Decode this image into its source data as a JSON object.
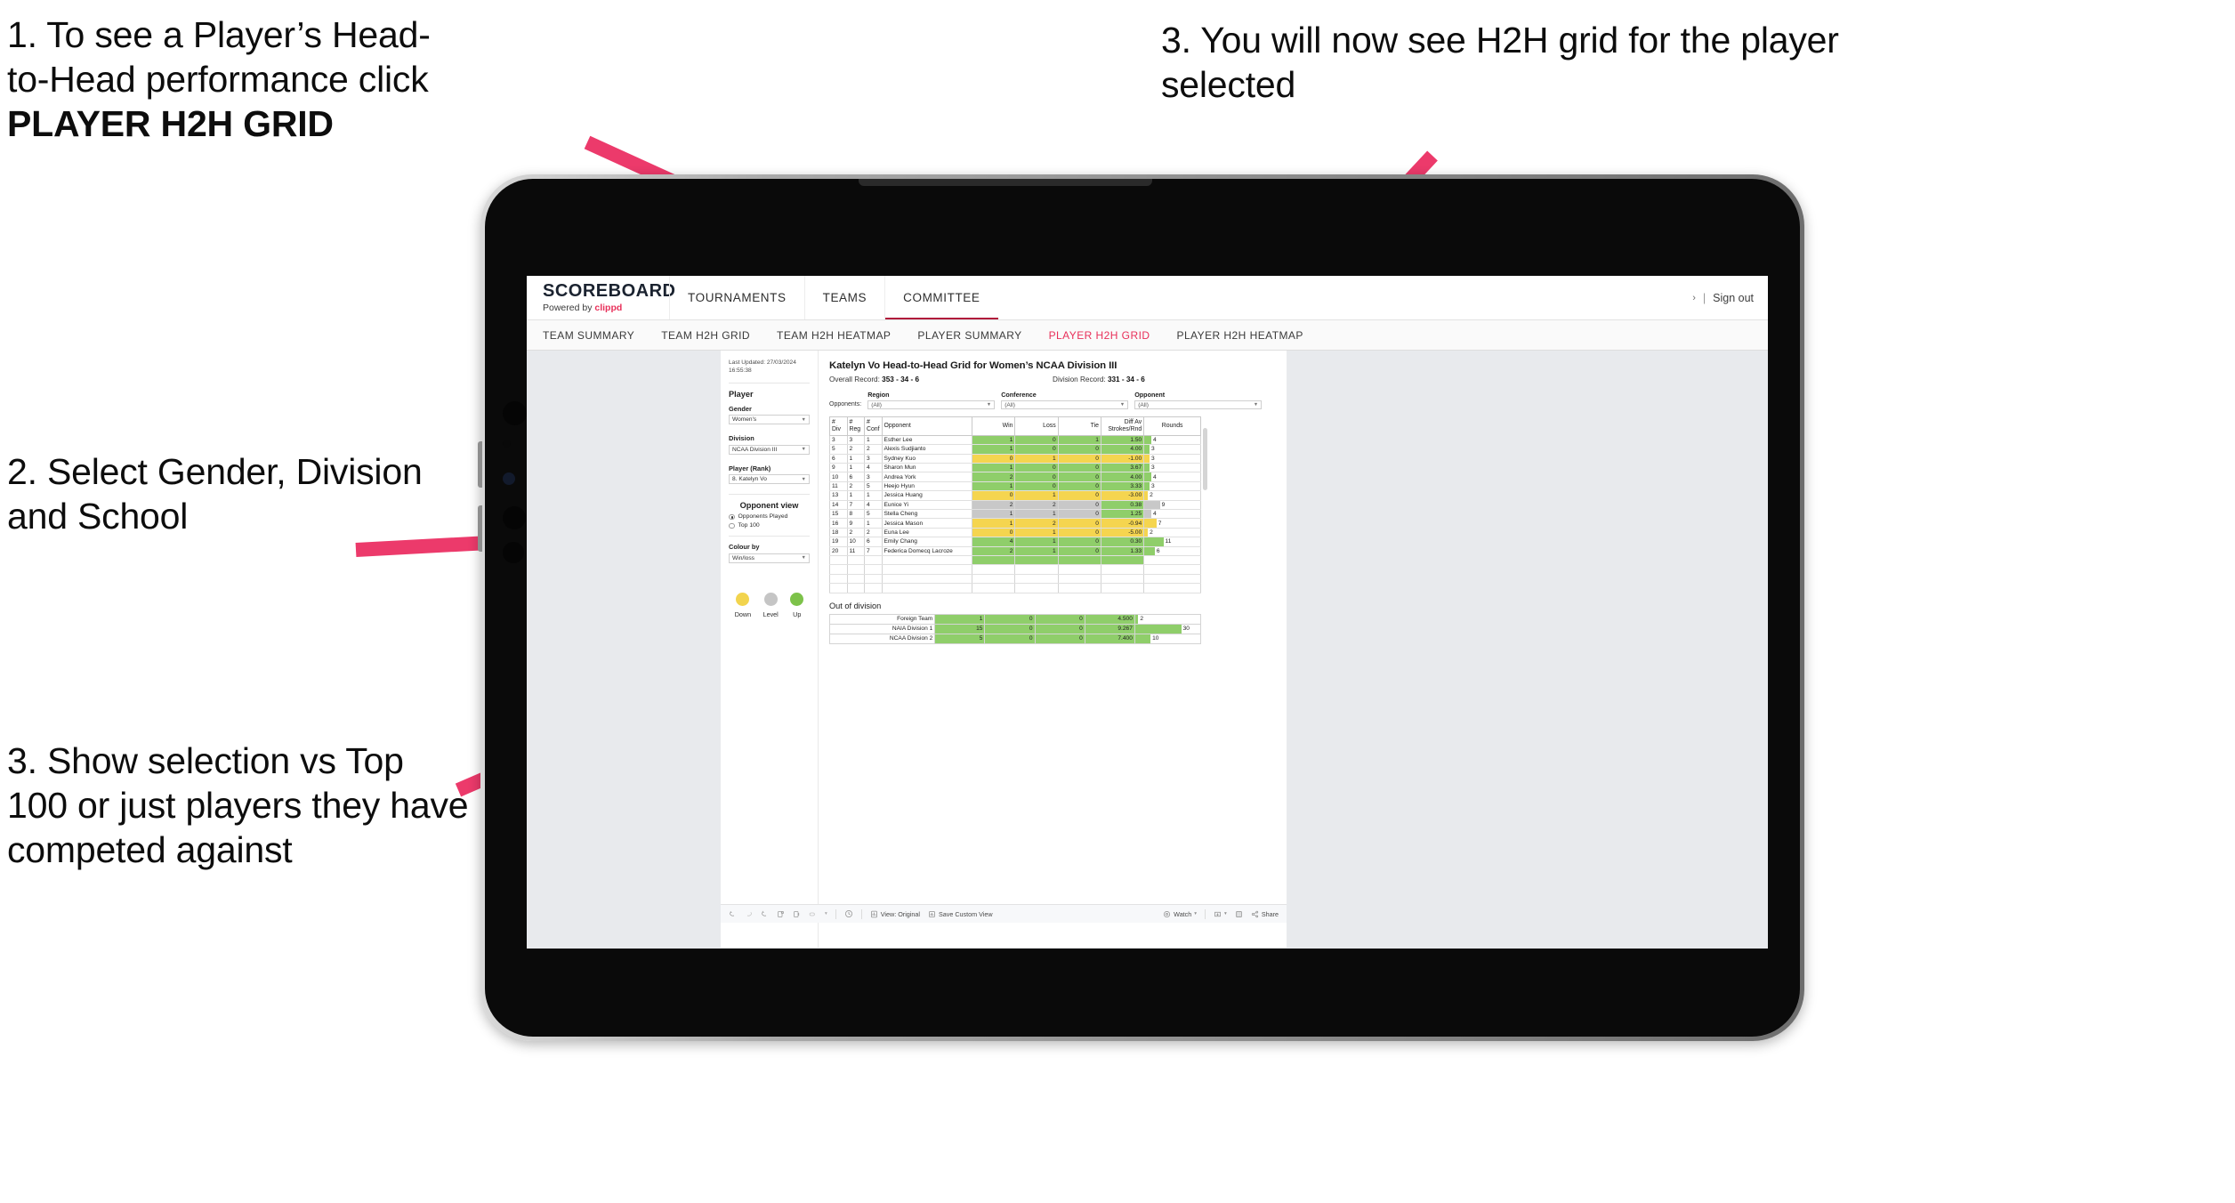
{
  "annotations": [
    {
      "id": "a1",
      "line1": "1. To see a Player’s Head-",
      "line2": "to-Head performance click",
      "line3": "PLAYER H2H GRID"
    },
    {
      "id": "a2",
      "text": "2. Select Gender, Division and School"
    },
    {
      "id": "a3",
      "text": "3. Show selection vs Top 100 or just players they have competed against"
    },
    {
      "id": "a4",
      "text": "3. You will now see H2H grid for the player selected"
    }
  ],
  "colors": {
    "accent_pink": "#e8305a",
    "arrow_pink": "#ec3a6b",
    "win_green": "#8fce6a",
    "loss_yellow": "#f5d54f",
    "level_grey": "#c8c8c8"
  },
  "app": {
    "logo": {
      "main": "SCOREBOARD",
      "powered": "Powered by",
      "brand": "clippd"
    },
    "header_nav": [
      {
        "label": "TOURNAMENTS",
        "active": false
      },
      {
        "label": "TEAMS",
        "active": false
      },
      {
        "label": "COMMITTEE",
        "active": true
      }
    ],
    "header_right": {
      "chevron": "›",
      "separator": "|",
      "sign_out": "Sign out"
    },
    "subnav": [
      {
        "label": "TEAM SUMMARY",
        "active": false
      },
      {
        "label": "TEAM H2H GRID",
        "active": false
      },
      {
        "label": "TEAM H2H HEATMAP",
        "active": false
      },
      {
        "label": "PLAYER SUMMARY",
        "active": false
      },
      {
        "label": "PLAYER H2H GRID",
        "active": true
      },
      {
        "label": "PLAYER H2H HEATMAP",
        "active": false
      }
    ]
  },
  "filter_panel": {
    "last_updated_line1": "Last Updated: 27/03/2024",
    "last_updated_line2": "16:55:38",
    "player_heading": "Player",
    "gender": {
      "label": "Gender",
      "value": "Women's"
    },
    "division": {
      "label": "Division",
      "value": "NCAA Division III"
    },
    "player_rank": {
      "label": "Player (Rank)",
      "value": "8. Katelyn Vo"
    },
    "opponent_view": {
      "heading": "Opponent view",
      "options": [
        {
          "label": "Opponents Played",
          "selected": true
        },
        {
          "label": "Top 100",
          "selected": false
        }
      ]
    },
    "colour_by": {
      "label": "Colour by",
      "value": "Win/loss"
    },
    "legend": [
      {
        "label": "Down",
        "color": "#f2d44e"
      },
      {
        "label": "Level",
        "color": "#c5c5c5"
      },
      {
        "label": "Up",
        "color": "#7dc24a"
      }
    ]
  },
  "view": {
    "title": "Katelyn Vo Head-to-Head Grid for Women’s NCAA Division III",
    "overall_record_label": "Overall Record:",
    "overall_record_value": "353 - 34 - 6",
    "division_record_label": "Division Record:",
    "division_record_value": "331 - 34 - 6",
    "opponents_label": "Opponents:",
    "opponent_filters": [
      {
        "title": "Region",
        "value": "(All)"
      },
      {
        "title": "Conference",
        "value": "(All)"
      },
      {
        "title": "Opponent",
        "value": "(All)"
      }
    ]
  },
  "chart_data": {
    "type": "table",
    "title": "Katelyn Vo Head-to-Head Grid for Women’s NCAA Division III",
    "columns": [
      "# Div",
      "# Reg",
      "# Conf",
      "Opponent",
      "Win",
      "Loss",
      "Tie",
      "Diff Av Strokes/Rnd",
      "Rounds"
    ],
    "rows": [
      {
        "div": "3",
        "reg": "3",
        "conf": "1",
        "opponent": "Esther Lee",
        "win": "1",
        "loss": "0",
        "tie": "1",
        "diff": "1.50",
        "rounds": "4",
        "state": "up"
      },
      {
        "div": "5",
        "reg": "2",
        "conf": "2",
        "opponent": "Alexis Sudjianto",
        "win": "1",
        "loss": "0",
        "tie": "0",
        "diff": "4.00",
        "rounds": "3",
        "state": "up"
      },
      {
        "div": "6",
        "reg": "1",
        "conf": "3",
        "opponent": "Sydney Kuo",
        "win": "0",
        "loss": "1",
        "tie": "0",
        "diff": "-1.00",
        "rounds": "3",
        "state": "down"
      },
      {
        "div": "9",
        "reg": "1",
        "conf": "4",
        "opponent": "Sharon Mun",
        "win": "1",
        "loss": "0",
        "tie": "0",
        "diff": "3.67",
        "rounds": "3",
        "state": "up"
      },
      {
        "div": "10",
        "reg": "6",
        "conf": "3",
        "opponent": "Andrea York",
        "win": "2",
        "loss": "0",
        "tie": "0",
        "diff": "4.00",
        "rounds": "4",
        "state": "up"
      },
      {
        "div": "11",
        "reg": "2",
        "conf": "5",
        "opponent": "Heejo Hyun",
        "win": "1",
        "loss": "0",
        "tie": "0",
        "diff": "3.33",
        "rounds": "3",
        "state": "up"
      },
      {
        "div": "13",
        "reg": "1",
        "conf": "1",
        "opponent": "Jessica Huang",
        "win": "0",
        "loss": "1",
        "tie": "0",
        "diff": "-3.00",
        "rounds": "2",
        "state": "down"
      },
      {
        "div": "14",
        "reg": "7",
        "conf": "4",
        "opponent": "Eunice Yi",
        "win": "2",
        "loss": "2",
        "tie": "0",
        "diff": "0.38",
        "rounds": "9",
        "state": "level"
      },
      {
        "div": "15",
        "reg": "8",
        "conf": "5",
        "opponent": "Stella Cheng",
        "win": "1",
        "loss": "1",
        "tie": "0",
        "diff": "1.25",
        "rounds": "4",
        "state": "level"
      },
      {
        "div": "16",
        "reg": "9",
        "conf": "1",
        "opponent": "Jessica Mason",
        "win": "1",
        "loss": "2",
        "tie": "0",
        "diff": "-0.94",
        "rounds": "7",
        "state": "down"
      },
      {
        "div": "18",
        "reg": "2",
        "conf": "2",
        "opponent": "Euna Lee",
        "win": "0",
        "loss": "1",
        "tie": "0",
        "diff": "-5.00",
        "rounds": "2",
        "state": "down"
      },
      {
        "div": "19",
        "reg": "10",
        "conf": "6",
        "opponent": "Emily Chang",
        "win": "4",
        "loss": "1",
        "tie": "0",
        "diff": "0.30",
        "rounds": "11",
        "state": "up"
      },
      {
        "div": "20",
        "reg": "11",
        "conf": "7",
        "opponent": "Federica Domecq Lacroze",
        "win": "2",
        "loss": "1",
        "tie": "0",
        "diff": "1.33",
        "rounds": "6",
        "state": "up"
      }
    ],
    "out_of_division": {
      "title": "Out of division",
      "rows": [
        {
          "label": "Foreign Team",
          "win": "1",
          "loss": "0",
          "tie": "0",
          "diff": "4.500",
          "rounds": "2",
          "state": "up"
        },
        {
          "label": "NAIA Division 1",
          "win": "15",
          "loss": "0",
          "tie": "0",
          "diff": "9.267",
          "rounds": "30",
          "state": "up"
        },
        {
          "label": "NCAA Division 2",
          "win": "5",
          "loss": "0",
          "tie": "0",
          "diff": "7.400",
          "rounds": "10",
          "state": "up"
        }
      ]
    },
    "rounds_max": 32
  },
  "toolbar": {
    "view_label": "View: Original",
    "save_label": "Save Custom View",
    "watch_label": "Watch",
    "share_label": "Share",
    "dropdown_caret": "▾"
  }
}
